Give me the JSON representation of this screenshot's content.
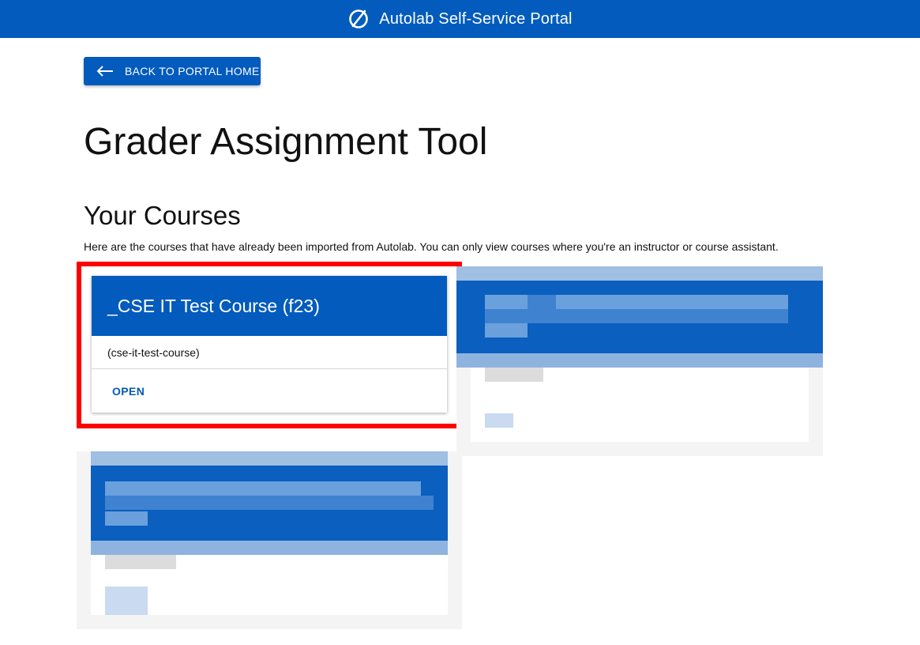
{
  "header": {
    "title": "Autolab Self-Service Portal",
    "logo_icon": "slashed-circle-icon",
    "color": "#025bbd"
  },
  "back_button": {
    "label": "BACK TO PORTAL HOME",
    "icon": "arrow-left-icon"
  },
  "page_title": "Grader Assignment Tool",
  "courses_section": {
    "title": "Your Courses",
    "description": "Here are the courses that have already been imported from Autolab. You can only view courses where you're an instructor or course assistant.",
    "courses": [
      {
        "name": "_CSE IT Test Course (f23)",
        "slug": "(cse-it-test-course)",
        "action": "OPEN"
      }
    ]
  },
  "colors": {
    "primary": "#025bbd",
    "highlight": "#ff0000"
  }
}
